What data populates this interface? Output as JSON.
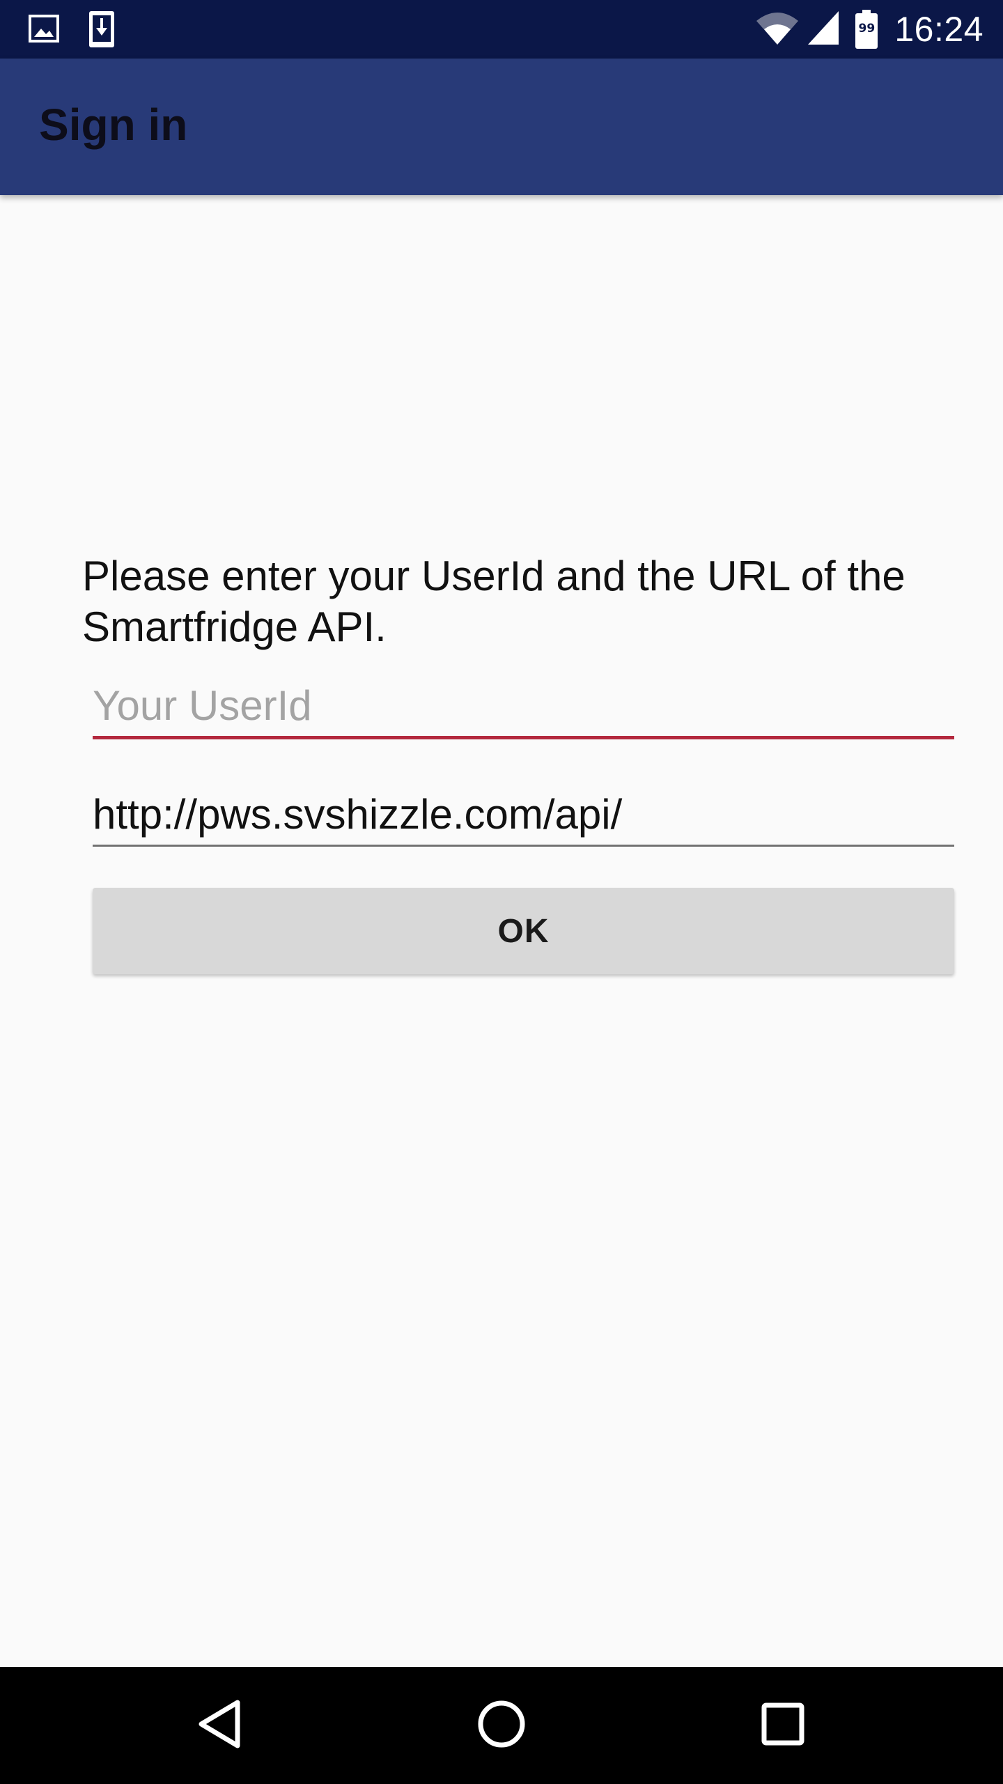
{
  "status_bar": {
    "time": "16:24",
    "battery_level": "99",
    "icons": [
      "image-icon",
      "download-icon",
      "wifi-icon",
      "signal-icon",
      "battery-icon"
    ]
  },
  "app_bar": {
    "title": "Sign in"
  },
  "form": {
    "instructions": "Please enter your UserId and the URL of the Smartfridge API.",
    "userid": {
      "value": "",
      "placeholder": "Your UserId"
    },
    "url": {
      "value": "http://pws.svshizzle.com/api/",
      "placeholder": ""
    },
    "ok_label": "OK"
  },
  "colors": {
    "status_bar": "#0b1748",
    "app_bar": "#283a78",
    "accent_underline": "#b3283e",
    "button": "#d8d8d8",
    "background": "#fafafa"
  },
  "nav_bar": {
    "icons": [
      "back-icon",
      "home-icon",
      "recents-icon"
    ]
  }
}
